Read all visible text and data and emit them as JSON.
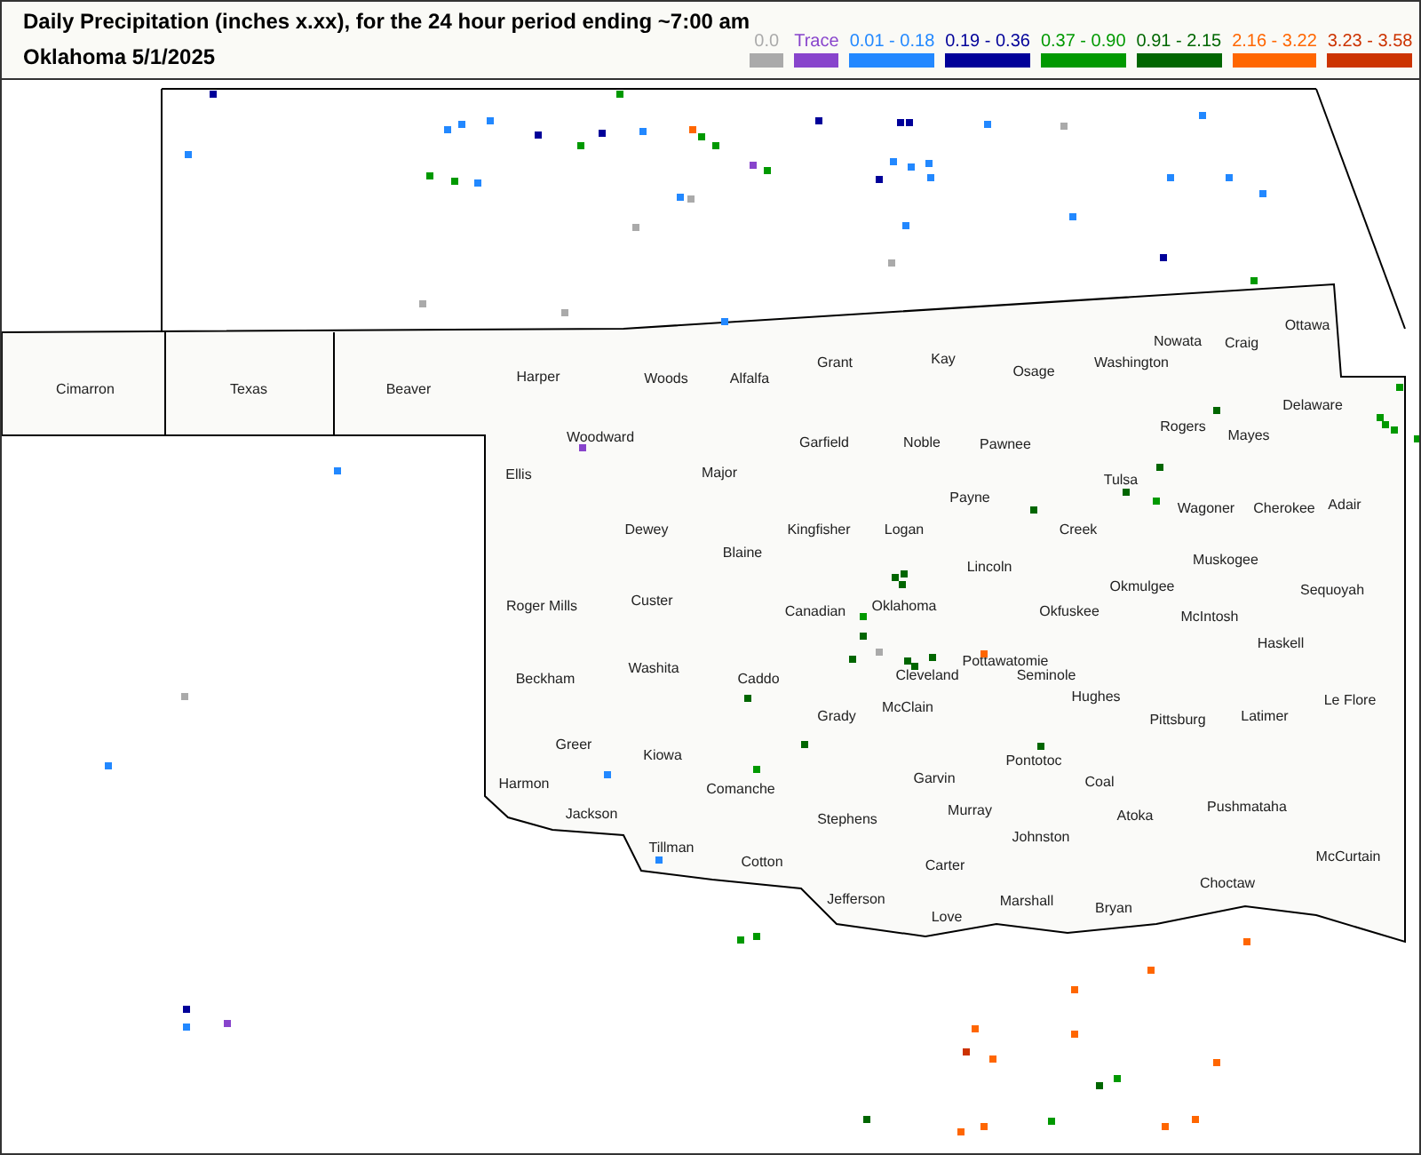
{
  "header": {
    "title": "Daily Precipitation (inches  x.xx),  for the 24 hour period ending ~7:00 am",
    "subtitle": "Oklahoma 5/1/2025"
  },
  "legend": [
    {
      "label": "0.0",
      "color": "#aaaaaa"
    },
    {
      "label": "Trace",
      "color": "#8844cc"
    },
    {
      "label": "0.01 - 0.18",
      "color": "#2288ff"
    },
    {
      "label": "0.19 - 0.36",
      "color": "#000099"
    },
    {
      "label": "0.37 - 0.90",
      "color": "#009900"
    },
    {
      "label": "0.91 - 2.15",
      "color": "#006600"
    },
    {
      "label": "2.16 - 3.22",
      "color": "#ff6600"
    },
    {
      "label": "3.23 - 3.58",
      "color": "#cc3300"
    }
  ],
  "counties": [
    "Ottawa",
    "Nowata",
    "Craig",
    "Cimarron",
    "Texas",
    "Beaver",
    "Harper",
    "Woods",
    "Alfalfa",
    "Grant",
    "Kay",
    "Osage",
    "Washington",
    "Delaware",
    "Woodward",
    "Garfield",
    "Noble",
    "Pawnee",
    "Rogers",
    "Mayes",
    "Ellis",
    "Major",
    "Tulsa",
    "Payne",
    "Wagoner",
    "Cherokee",
    "Adair",
    "Dewey",
    "Kingfisher",
    "Logan",
    "Creek",
    "Blaine",
    "Lincoln",
    "Muskogee",
    "Roger Mills",
    "Custer",
    "Canadian",
    "Oklahoma",
    "Okfuskee",
    "Okmulgee",
    "McIntosh",
    "Sequoyah",
    "Haskell",
    "Beckham",
    "Washita",
    "Caddo",
    "Cleveland",
    "Pottawatomie",
    "Seminole",
    "Grady",
    "McClain",
    "Hughes",
    "Pittsburg",
    "Latimer",
    "Le Flore",
    "Greer",
    "Kiowa",
    "Pontotoc",
    "Harmon",
    "Comanche",
    "Garvin",
    "Coal",
    "Jackson",
    "Stephens",
    "Murray",
    "Atoka",
    "Pushmataha",
    "Tillman",
    "Cotton",
    "Carter",
    "Johnston",
    "McCurtain",
    "Jefferson",
    "Love",
    "Marshall",
    "Bryan",
    "Choctaw"
  ],
  "stations": [
    {
      "color": "#000099"
    },
    {
      "color": "#2288ff"
    },
    {
      "color": "#2288ff"
    },
    {
      "color": "#2288ff"
    },
    {
      "color": "#2288ff"
    },
    {
      "color": "#000099"
    },
    {
      "color": "#009900"
    },
    {
      "color": "#000099"
    },
    {
      "color": "#009900"
    },
    {
      "color": "#2288ff"
    },
    {
      "color": "#ff6600"
    },
    {
      "color": "#009900"
    },
    {
      "color": "#009900"
    },
    {
      "color": "#8844cc"
    },
    {
      "color": "#009900"
    },
    {
      "color": "#000099"
    },
    {
      "color": "#000099"
    },
    {
      "color": "#000099"
    },
    {
      "color": "#2288ff"
    },
    {
      "color": "#aaaaaa"
    },
    {
      "color": "#2288ff"
    },
    {
      "color": "#000099"
    },
    {
      "color": "#2288ff"
    },
    {
      "color": "#2288ff"
    },
    {
      "color": "#2288ff"
    },
    {
      "color": "#2288ff"
    },
    {
      "color": "#009900"
    },
    {
      "color": "#009900"
    },
    {
      "color": "#2288ff"
    },
    {
      "color": "#2288ff"
    },
    {
      "color": "#aaaaaa"
    },
    {
      "color": "#2288ff"
    },
    {
      "color": "#2288ff"
    },
    {
      "color": "#2288ff"
    },
    {
      "color": "#2288ff"
    },
    {
      "color": "#aaaaaa"
    },
    {
      "color": "#2288ff"
    },
    {
      "color": "#aaaaaa"
    },
    {
      "color": "#000099"
    },
    {
      "color": "#009900"
    },
    {
      "color": "#aaaaaa"
    },
    {
      "color": "#aaaaaa"
    },
    {
      "color": "#2288ff"
    },
    {
      "color": "#8844cc"
    },
    {
      "color": "#2288ff"
    },
    {
      "color": "#aaaaaa"
    },
    {
      "color": "#2288ff"
    },
    {
      "color": "#2288ff"
    },
    {
      "color": "#2288ff"
    },
    {
      "color": "#009900"
    },
    {
      "color": "#009900"
    },
    {
      "color": "#000099"
    },
    {
      "color": "#2288ff"
    },
    {
      "color": "#8844cc"
    },
    {
      "color": "#ff6600"
    },
    {
      "color": "#ff6600"
    },
    {
      "color": "#ff6600"
    },
    {
      "color": "#ff6600"
    },
    {
      "color": "#cc3300"
    },
    {
      "color": "#ff6600"
    },
    {
      "color": "#ff6600"
    },
    {
      "color": "#009900"
    },
    {
      "color": "#006600"
    },
    {
      "color": "#009900"
    },
    {
      "color": "#006600"
    },
    {
      "color": "#ff6600"
    },
    {
      "color": "#ff6600"
    },
    {
      "color": "#ff6600"
    },
    {
      "color": "#ff6600"
    },
    {
      "color": "#ff6600"
    },
    {
      "color": "#006600"
    },
    {
      "color": "#006600"
    },
    {
      "color": "#006600"
    },
    {
      "color": "#009900"
    },
    {
      "color": "#006600"
    },
    {
      "color": "#006600"
    },
    {
      "color": "#006600"
    },
    {
      "color": "#006600"
    },
    {
      "color": "#006600"
    },
    {
      "color": "#006600"
    },
    {
      "color": "#006600"
    },
    {
      "color": "#009900"
    },
    {
      "color": "#006600"
    },
    {
      "color": "#006600"
    },
    {
      "color": "#006600"
    },
    {
      "color": "#006600"
    },
    {
      "color": "#009900"
    },
    {
      "color": "#006600"
    },
    {
      "color": "#ff6600"
    },
    {
      "color": "#aaaaaa"
    },
    {
      "color": "#009900"
    },
    {
      "color": "#009900"
    },
    {
      "color": "#009900"
    },
    {
      "color": "#009900"
    },
    {
      "color": "#009900"
    }
  ]
}
